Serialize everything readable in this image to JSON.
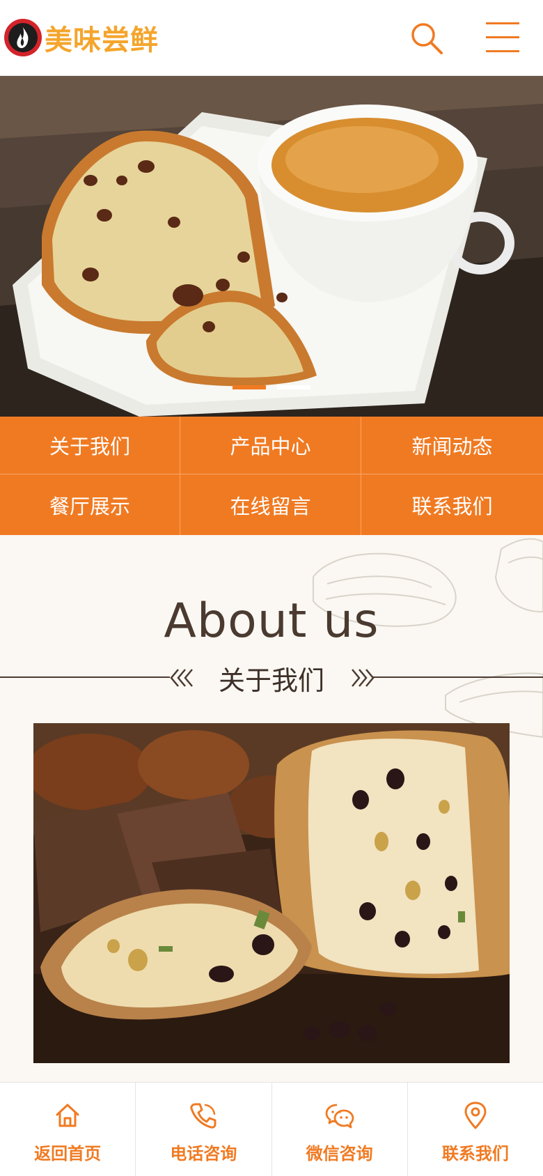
{
  "brand": {
    "name": "美味尝鲜",
    "accent_color": "#f07a22",
    "logo_text_color": "#f4a52d"
  },
  "header": {
    "search_icon": "search-icon",
    "menu_icon": "hamburger-menu-icon"
  },
  "banner": {
    "slide_count": 2,
    "active_slide": 1
  },
  "nav": {
    "items": [
      {
        "label": "关于我们"
      },
      {
        "label": "产品中心"
      },
      {
        "label": "新闻动态"
      },
      {
        "label": "餐厅展示"
      },
      {
        "label": "在线留言"
      },
      {
        "label": "联系我们"
      }
    ]
  },
  "about": {
    "title": "About us",
    "subtitle": "关于我们"
  },
  "bottom_bar": {
    "items": [
      {
        "label": "返回首页",
        "icon": "home-icon"
      },
      {
        "label": "电话咨询",
        "icon": "phone-icon"
      },
      {
        "label": "微信咨询",
        "icon": "wechat-icon"
      },
      {
        "label": "联系我们",
        "icon": "location-pin-icon"
      }
    ]
  }
}
